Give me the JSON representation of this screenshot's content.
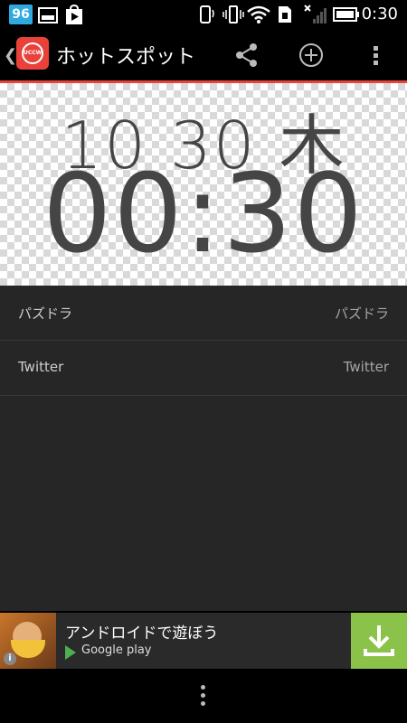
{
  "status_bar": {
    "badge": "96",
    "time": "0:30"
  },
  "app_bar": {
    "title": "ホットスポット",
    "icon_text": "UCCW"
  },
  "widget_preview": {
    "date": "10 30 木",
    "time": "00:30"
  },
  "settings": [
    {
      "label": "パズドラ",
      "value": "パズドラ"
    },
    {
      "label": "Twitter",
      "value": "Twitter"
    }
  ],
  "ad": {
    "headline": "アンドロイドで遊ぼう",
    "store": "Google play",
    "info_glyph": "i"
  },
  "colors": {
    "accent_red": "#e8423a",
    "download_green": "#8bc34a",
    "status_badge_blue": "#2fa9df"
  }
}
